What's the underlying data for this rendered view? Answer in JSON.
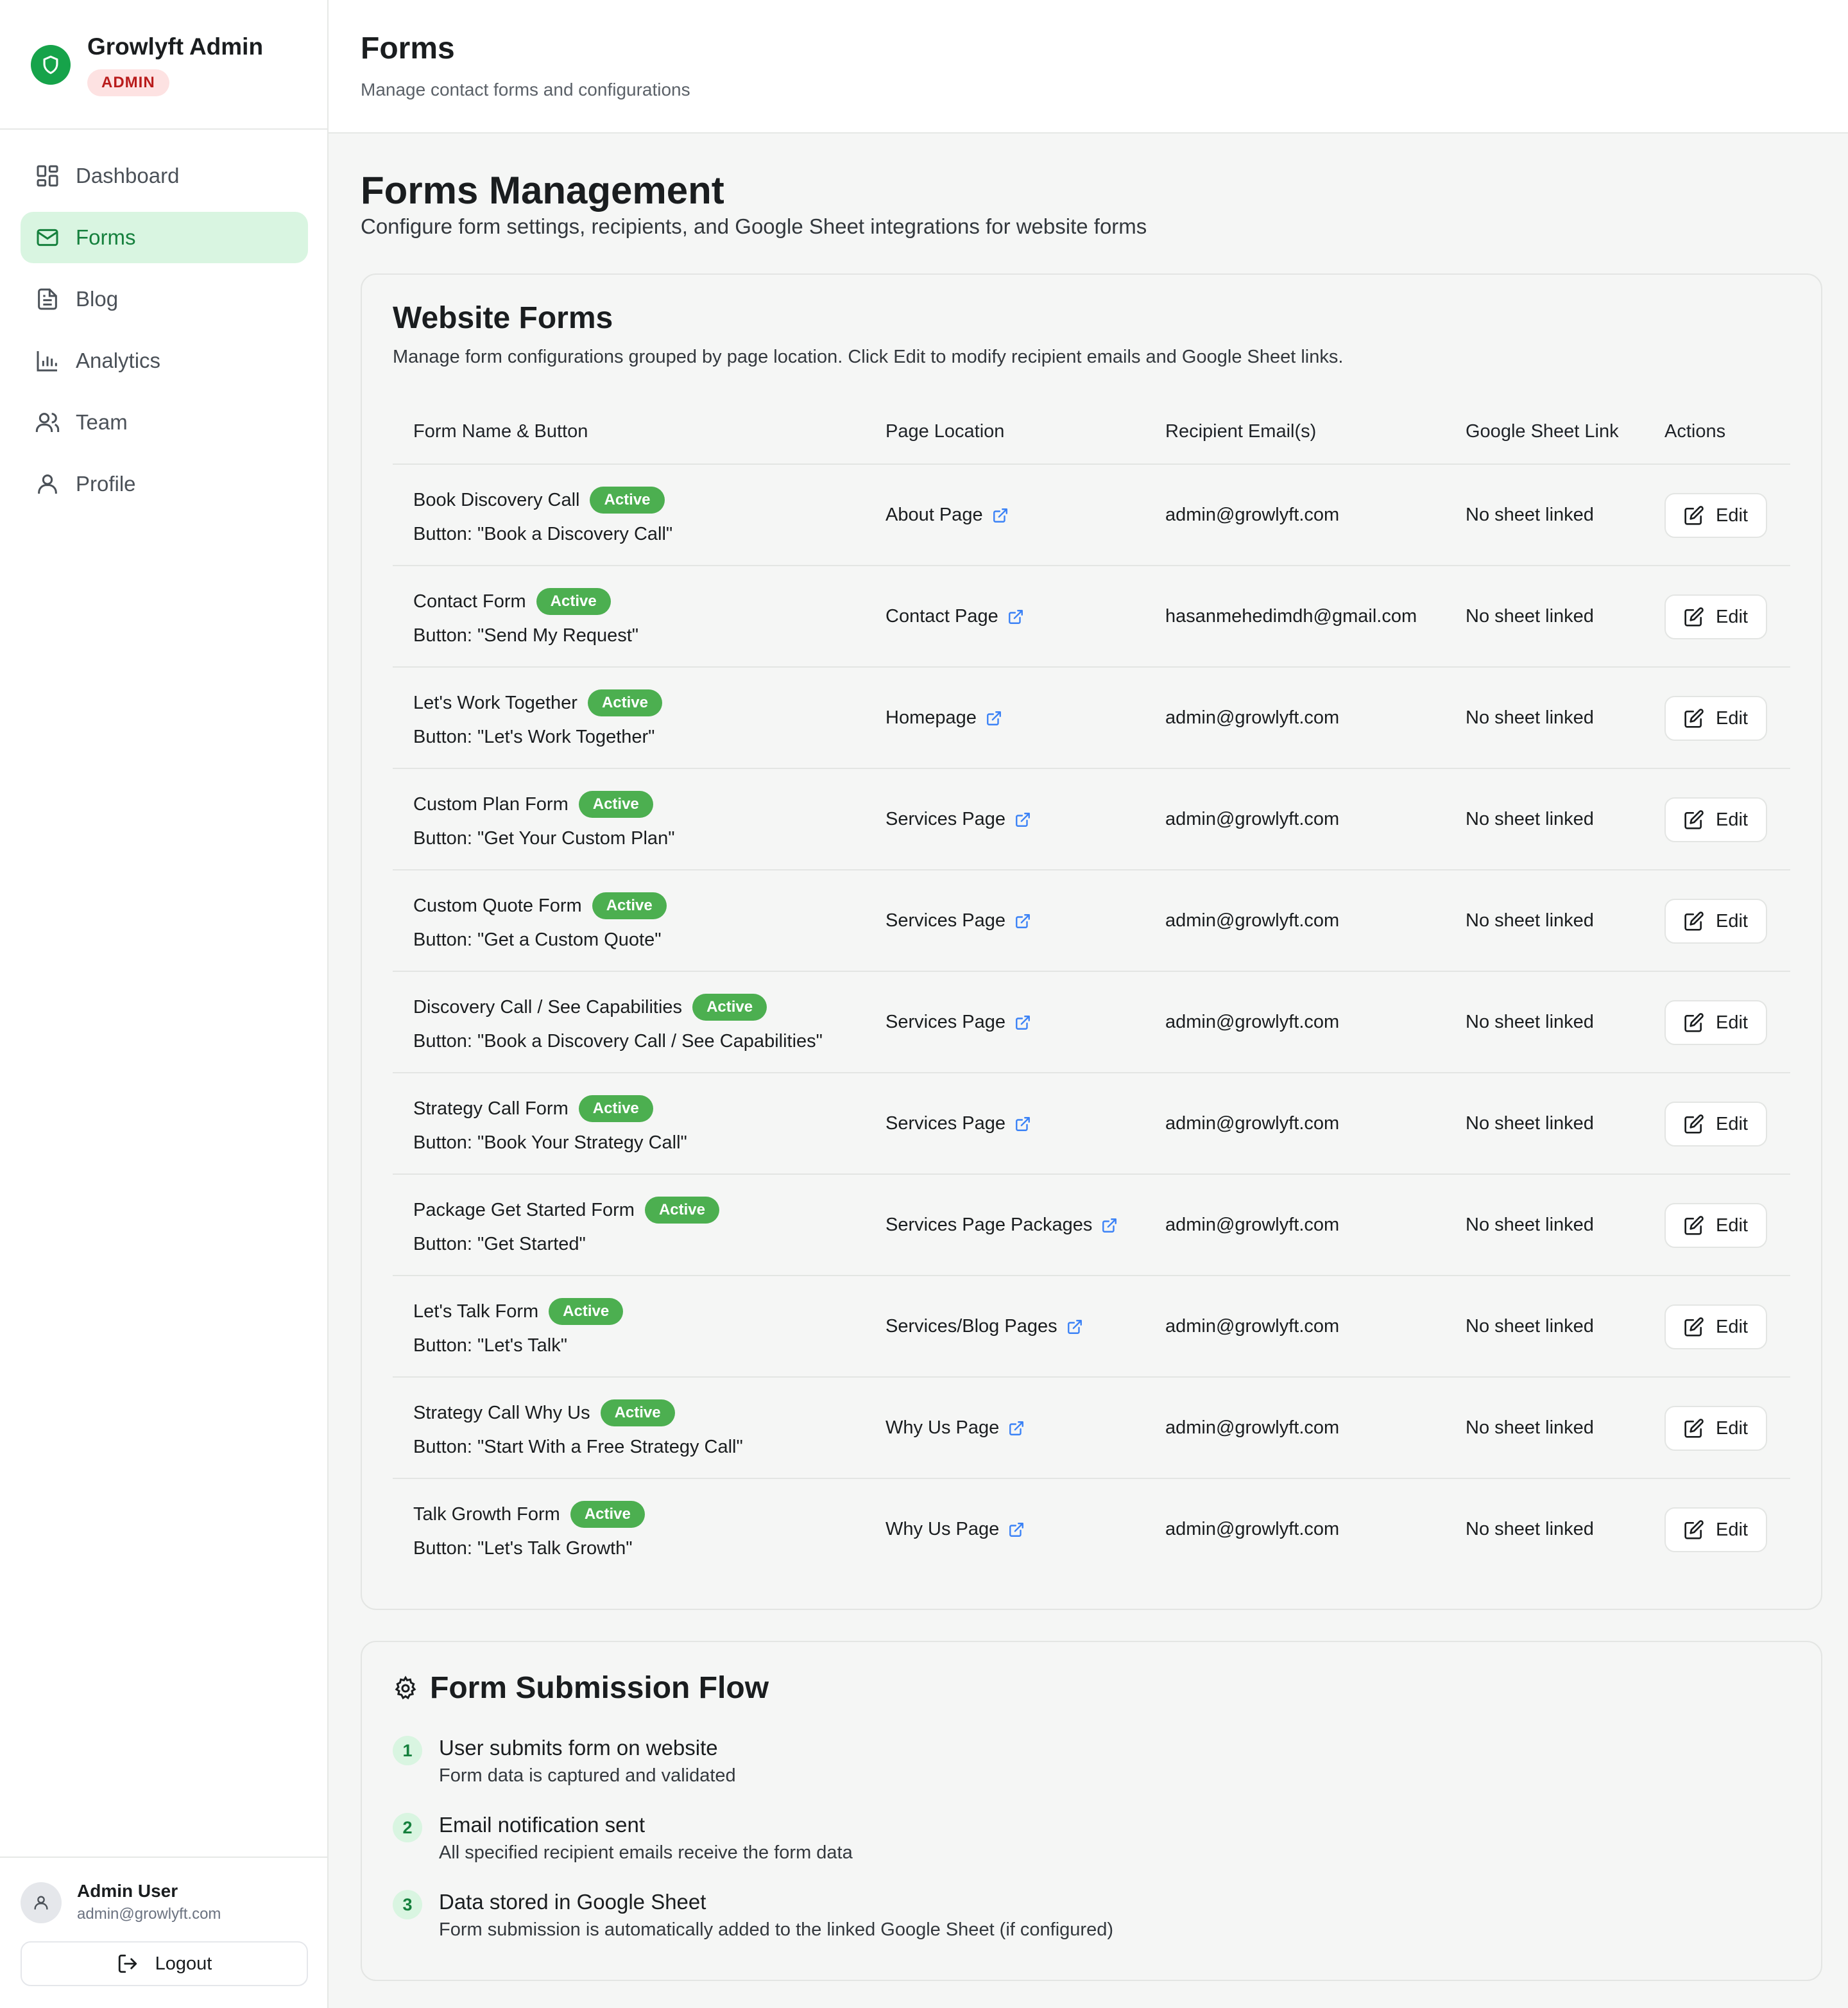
{
  "brand": {
    "title": "Growlyft Admin",
    "badge": "ADMIN"
  },
  "nav": [
    {
      "label": "Dashboard",
      "icon": "dashboard-icon",
      "active": false
    },
    {
      "label": "Forms",
      "icon": "mail-icon",
      "active": true
    },
    {
      "label": "Blog",
      "icon": "document-icon",
      "active": false
    },
    {
      "label": "Analytics",
      "icon": "bar-chart-icon",
      "active": false
    },
    {
      "label": "Team",
      "icon": "users-icon",
      "active": false
    },
    {
      "label": "Profile",
      "icon": "user-icon",
      "active": false
    }
  ],
  "user": {
    "name": "Admin User",
    "email": "admin@growlyft.com",
    "logout_label": "Logout"
  },
  "topbar": {
    "title": "Forms",
    "subtitle": "Manage contact forms and configurations"
  },
  "page": {
    "title": "Forms Management",
    "subtitle": "Configure form settings, recipients, and Google Sheet integrations for website forms"
  },
  "website_forms": {
    "title": "Website Forms",
    "subtitle": "Manage form configurations grouped by page location. Click Edit to modify recipient emails and Google Sheet links.",
    "columns": [
      "Form Name & Button",
      "Page Location",
      "Recipient Email(s)",
      "Google Sheet Link",
      "Actions"
    ],
    "rows": [
      {
        "name": "Book Discovery Call",
        "status": "Active",
        "button": "Button: \"Book a Discovery Call\"",
        "location": "About Page",
        "email": "admin@growlyft.com",
        "sheet": "No sheet linked",
        "action": "Edit"
      },
      {
        "name": "Contact Form",
        "status": "Active",
        "button": "Button: \"Send My Request\"",
        "location": "Contact Page",
        "email": "hasanmehedimdh@gmail.com",
        "sheet": "No sheet linked",
        "action": "Edit"
      },
      {
        "name": "Let's Work Together",
        "status": "Active",
        "button": "Button: \"Let's Work Together\"",
        "location": "Homepage",
        "email": "admin@growlyft.com",
        "sheet": "No sheet linked",
        "action": "Edit"
      },
      {
        "name": "Custom Plan Form",
        "status": "Active",
        "button": "Button: \"Get Your Custom Plan\"",
        "location": "Services Page",
        "email": "admin@growlyft.com",
        "sheet": "No sheet linked",
        "action": "Edit"
      },
      {
        "name": "Custom Quote Form",
        "status": "Active",
        "button": "Button: \"Get a Custom Quote\"",
        "location": "Services Page",
        "email": "admin@growlyft.com",
        "sheet": "No sheet linked",
        "action": "Edit"
      },
      {
        "name": "Discovery Call / See Capabilities",
        "status": "Active",
        "button": "Button: \"Book a Discovery Call / See Capabilities\"",
        "location": "Services Page",
        "email": "admin@growlyft.com",
        "sheet": "No sheet linked",
        "action": "Edit"
      },
      {
        "name": "Strategy Call Form",
        "status": "Active",
        "button": "Button: \"Book Your Strategy Call\"",
        "location": "Services Page",
        "email": "admin@growlyft.com",
        "sheet": "No sheet linked",
        "action": "Edit"
      },
      {
        "name": "Package Get Started Form",
        "status": "Active",
        "button": "Button: \"Get Started\"",
        "location": "Services Page Packages",
        "email": "admin@growlyft.com",
        "sheet": "No sheet linked",
        "action": "Edit"
      },
      {
        "name": "Let's Talk Form",
        "status": "Active",
        "button": "Button: \"Let's Talk\"",
        "location": "Services/Blog Pages",
        "email": "admin@growlyft.com",
        "sheet": "No sheet linked",
        "action": "Edit"
      },
      {
        "name": "Strategy Call Why Us",
        "status": "Active",
        "button": "Button: \"Start With a Free Strategy Call\"",
        "location": "Why Us Page",
        "email": "admin@growlyft.com",
        "sheet": "No sheet linked",
        "action": "Edit"
      },
      {
        "name": "Talk Growth Form",
        "status": "Active",
        "button": "Button: \"Let's Talk Growth\"",
        "location": "Why Us Page",
        "email": "admin@growlyft.com",
        "sheet": "No sheet linked",
        "action": "Edit"
      }
    ]
  },
  "flow": {
    "title": "Form Submission Flow",
    "steps": [
      {
        "num": "1",
        "title": "User submits form on website",
        "desc": "Form data is captured and validated"
      },
      {
        "num": "2",
        "title": "Email notification sent",
        "desc": "All specified recipient emails receive the form data"
      },
      {
        "num": "3",
        "title": "Data stored in Google Sheet",
        "desc": "Form submission is automatically added to the linked Google Sheet (if configured)"
      }
    ]
  },
  "colors": {
    "accent": "#16a34a",
    "active_badge": "#4caf50",
    "nav_active_bg": "#d9f5e1",
    "admin_badge_bg": "#fde2e2",
    "link_icon": "#3b82f6"
  }
}
